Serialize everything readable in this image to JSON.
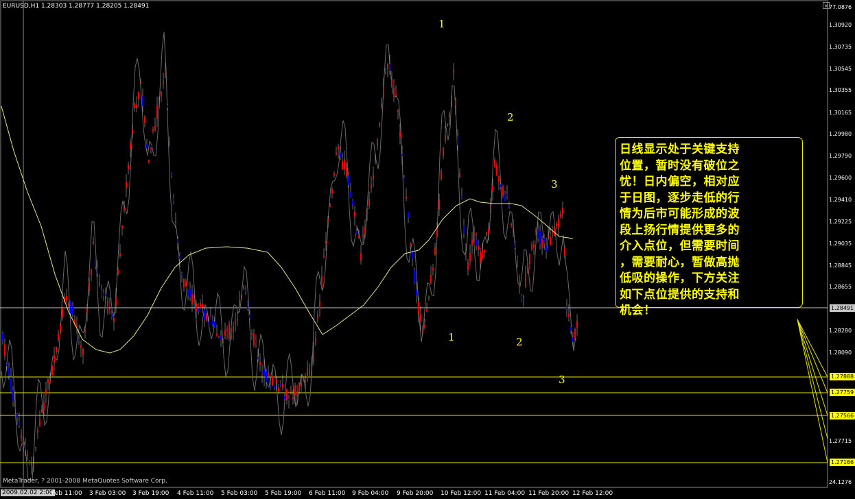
{
  "header": {
    "title": "EURUSD,H1  1.28303 1.28777 1.28205 1.28491"
  },
  "copyright": "MetaTrader, ? 2001-2008 MetaQuotes Software Corp.",
  "note_lines": [
    "日线显示处于关键支持",
    "位置，暂时没有破位之",
    "忧！日内偏空，相对应",
    "于日图，逐步走低的行",
    "情为后市可能形成的波",
    "段上扬行情提供更多的",
    "介入点位，但需要时间",
    "，需要耐心，暂做高抛",
    "低吸的操作，下方关注",
    "如下点位提供的支持和",
    "机会！"
  ],
  "waves": [
    "1",
    "2",
    "3",
    "1",
    "2",
    "3"
  ],
  "price_axis": {
    "labels": [
      "77.0876",
      "1.30920",
      "1.30735",
      "1.30545",
      "1.30355",
      "1.30165",
      "1.29980",
      "1.29790",
      "1.29600",
      "1.29410",
      "1.29225",
      "1.29035",
      "1.28845",
      "1.28655",
      "1.28280",
      "1.28090",
      "1.27715",
      "24.1276"
    ],
    "current": "1.28491",
    "levels": [
      "1.27888",
      "1.27759",
      "1.27566",
      "1.27166"
    ]
  },
  "time_axis": [
    "2009.02.02 2:00",
    "Feb 11:00",
    "3 Feb 03:00",
    "3 Feb 19:00",
    "4 Feb 11:00",
    "5 Feb 03:00",
    "5 Feb 19:00",
    "6 Feb 11:00",
    "9 Feb 04:00",
    "9 Feb 20:00",
    "10 Feb 12:00",
    "11 Feb 04:00",
    "11 Feb 20:00",
    "12 Feb 12:00"
  ],
  "colors": {
    "bull": "#ff0000",
    "bear": "#0000ff",
    "ma": "#e6e68c",
    "level": "#e6e600",
    "osc": "#6a6a6a"
  }
}
